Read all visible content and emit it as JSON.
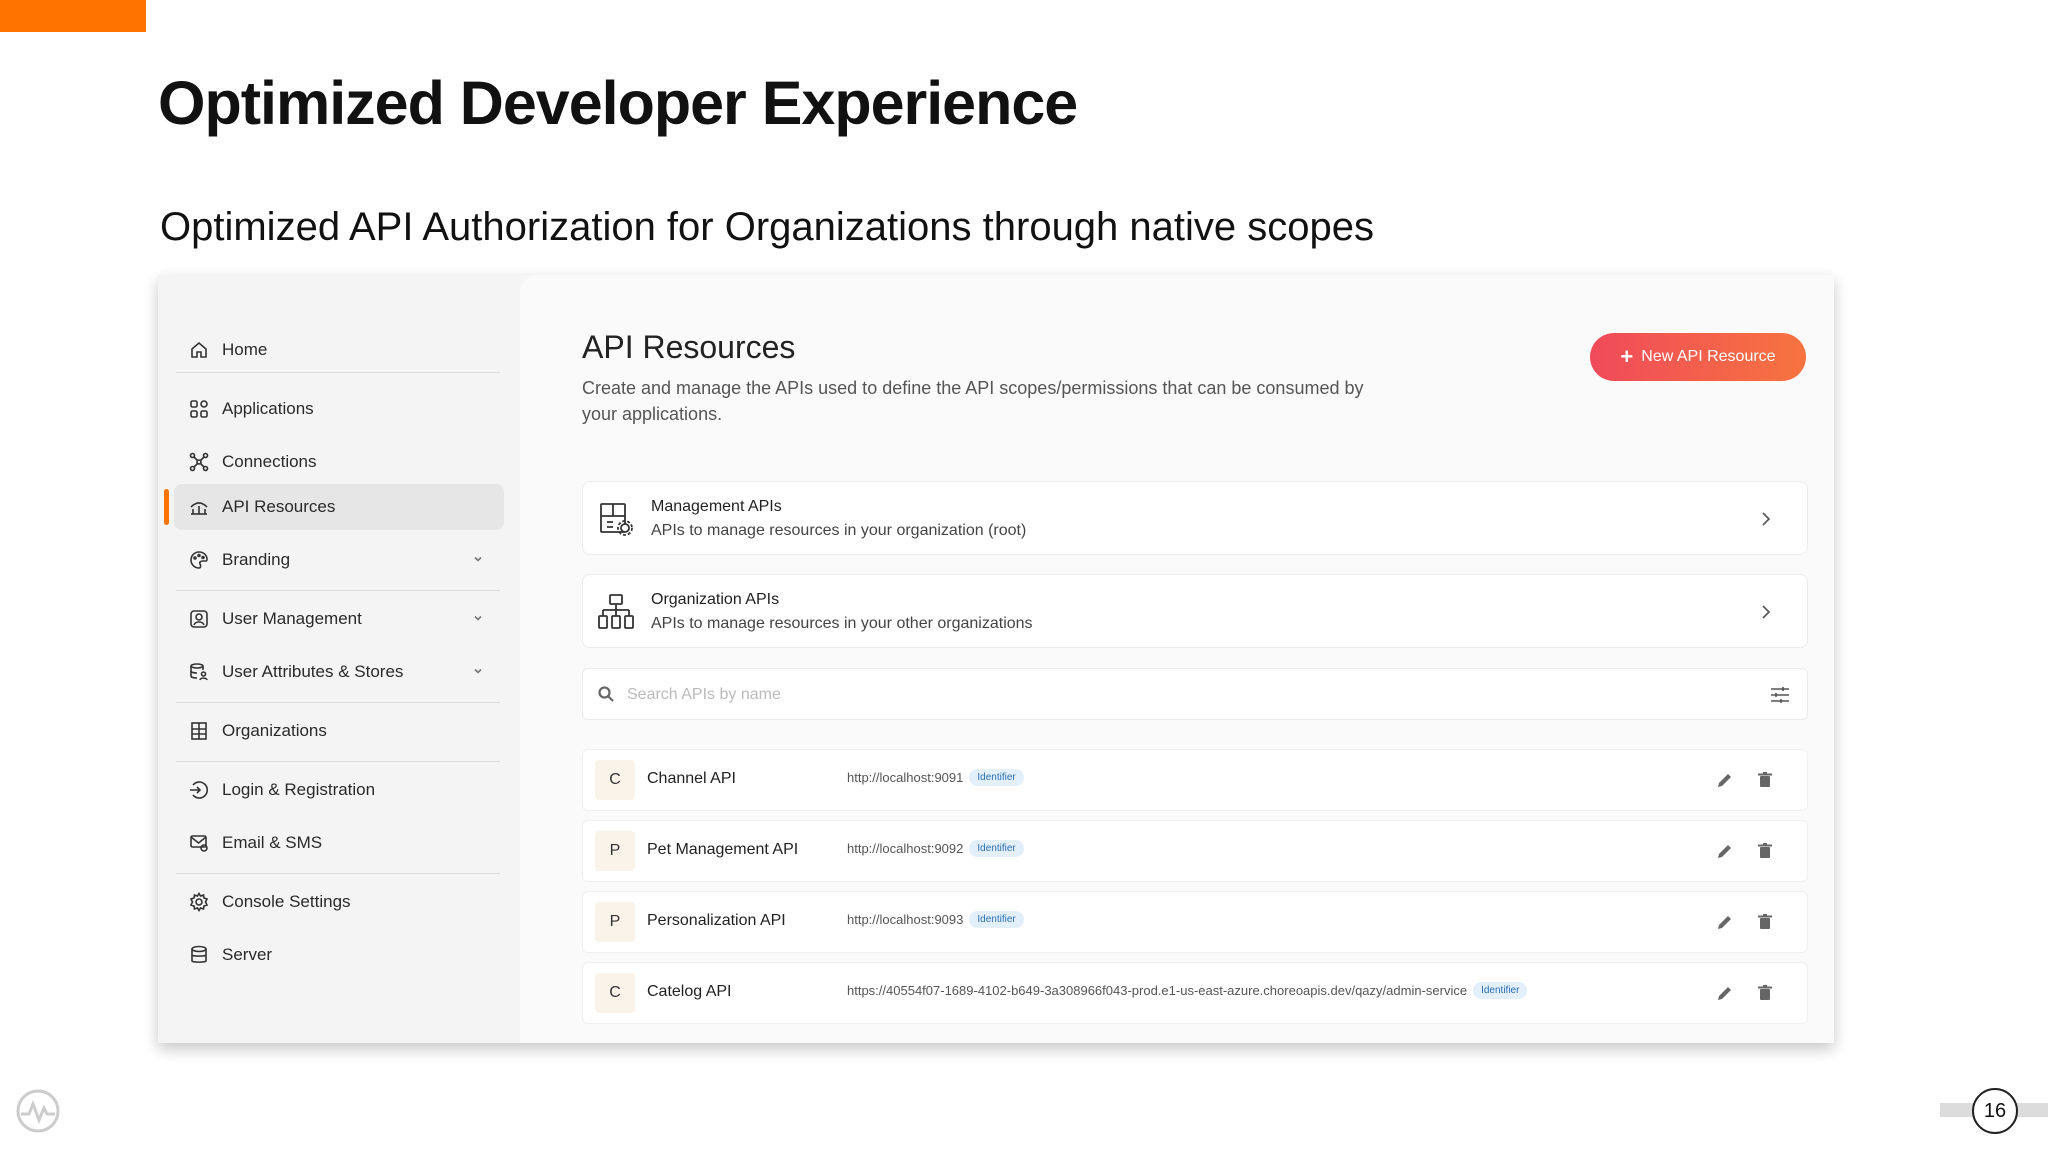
{
  "slide": {
    "title": "Optimized Developer Experience",
    "subtitle": "Optimized API Authorization for Organizations through native scopes",
    "page_number": "16",
    "accent_color": "#ff7300"
  },
  "sidebar": {
    "items": [
      {
        "label": "Home",
        "icon": "home-icon"
      },
      {
        "label": "Applications",
        "icon": "grid-icon"
      },
      {
        "label": "Connections",
        "icon": "connections-icon"
      },
      {
        "label": "API Resources",
        "icon": "api-icon",
        "active": true
      },
      {
        "label": "Branding",
        "icon": "palette-icon",
        "expandable": true
      },
      {
        "label": "User Management",
        "icon": "user-icon",
        "expandable": true
      },
      {
        "label": "User Attributes & Stores",
        "icon": "user-store-icon",
        "expandable": true
      },
      {
        "label": "Organizations",
        "icon": "building-icon"
      },
      {
        "label": "Login & Registration",
        "icon": "login-icon"
      },
      {
        "label": "Email & SMS",
        "icon": "mail-icon"
      },
      {
        "label": "Console Settings",
        "icon": "gear-icon"
      },
      {
        "label": "Server",
        "icon": "database-icon"
      }
    ]
  },
  "main": {
    "title": "API Resources",
    "description": "Create and manage the APIs used to define the API scopes/permissions that can be consumed by your applications.",
    "new_button_label": "New API Resource",
    "cards": [
      {
        "title": "Management APIs",
        "subtitle": "APIs to manage resources in your organization (root)",
        "icon": "management-api-icon"
      },
      {
        "title": "Organization APIs",
        "subtitle": "APIs to manage resources in your other organizations",
        "icon": "organization-tree-icon"
      }
    ],
    "search": {
      "placeholder": "Search APIs by name"
    },
    "resources": [
      {
        "initial": "C",
        "name": "Channel API",
        "identifier": "http://localhost:9091",
        "badge": "Identifier"
      },
      {
        "initial": "P",
        "name": "Pet Management API",
        "identifier": "http://localhost:9092",
        "badge": "Identifier"
      },
      {
        "initial": "P",
        "name": "Personalization API",
        "identifier": "http://localhost:9093",
        "badge": "Identifier"
      },
      {
        "initial": "C",
        "name": "Catelog API",
        "identifier": "https://40554f07-1689-4102-b649-3a308966f043-prod.e1-us-east-azure.choreoapis.dev/qazy/admin-service",
        "badge": "Identifier"
      }
    ]
  }
}
